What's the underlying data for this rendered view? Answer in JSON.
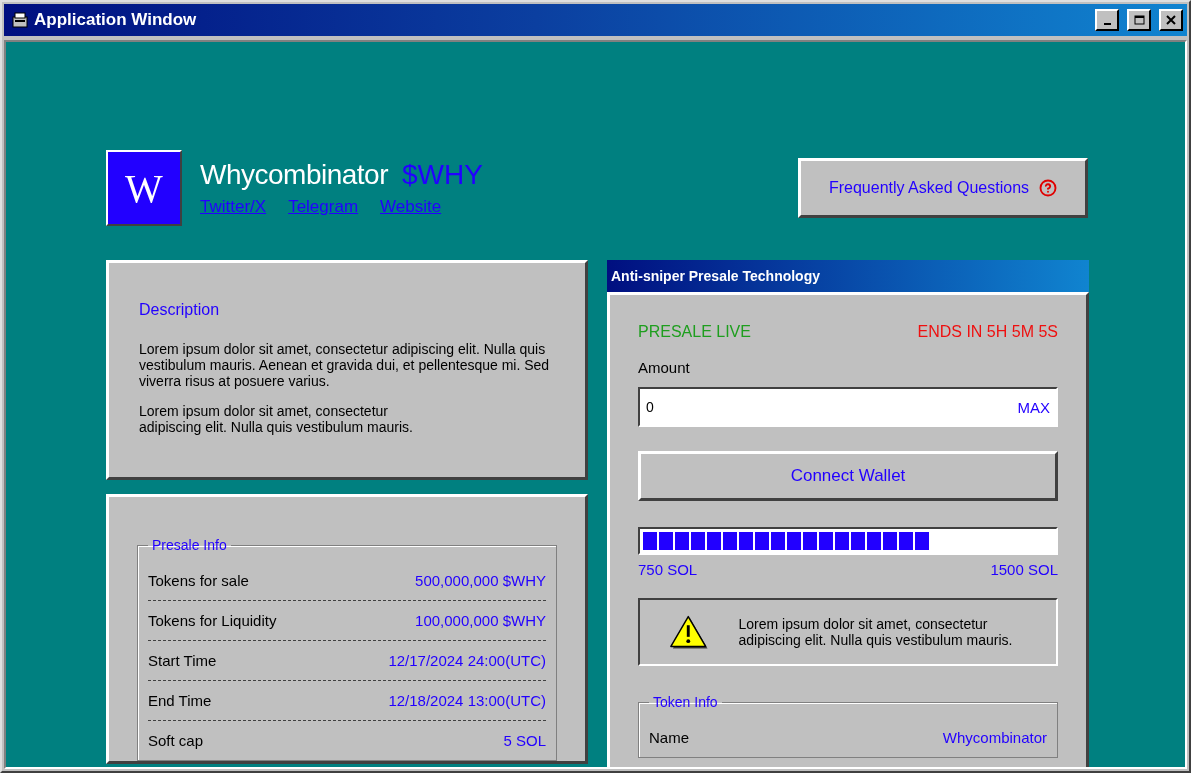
{
  "window": {
    "title": "Application Window"
  },
  "project": {
    "logo_letter": "W",
    "name": "Whycombinator",
    "ticker": "$WHY",
    "links": [
      "Twitter/X",
      "Telegram",
      "Website"
    ]
  },
  "faq_button": {
    "label": "Frequently Asked Questions"
  },
  "description": {
    "title": "Description",
    "paragraphs": [
      "Lorem ipsum dolor sit amet, consectetur adipiscing elit. Nulla quis vestibulum mauris. Aenean et gravida dui, et pellentesque mi. Sed viverra risus at posuere varius.",
      "Lorem ipsum dolor sit amet, consectetur adipiscing elit. Nulla quis vestibulum mauris."
    ]
  },
  "presale_info": {
    "title": "Presale Info",
    "rows": [
      {
        "label": "Tokens for sale",
        "value": "500,000,000 $WHY"
      },
      {
        "label": "Tokens for Liquidity",
        "value": "100,000,000 $WHY"
      },
      {
        "label": "Start Time",
        "value": "12/17/2024 24:00(UTC)"
      },
      {
        "label": "End Time",
        "value": "12/18/2024 13:00(UTC)"
      },
      {
        "label": "Soft cap",
        "value": "5 SOL"
      }
    ]
  },
  "presale_panel": {
    "title": "Anti-sniper Presale Technology",
    "status": "PRESALE LIVE",
    "countdown": "ENDS IN 5H 5M 5S",
    "amount_label": "Amount",
    "amount_value": "0",
    "max_label": "MAX",
    "connect_button": "Connect Wallet",
    "progress": {
      "level": 0.7,
      "min_label": "750 SOL",
      "max_label": "1500 SOL"
    },
    "warning": "Lorem ipsum dolor sit amet, consectetur adipiscing elit. Nulla quis vestibulum mauris.",
    "token_info": {
      "title": "Token Info",
      "rows": [
        {
          "label": "Name",
          "value": "Whycombinator"
        }
      ]
    }
  }
}
